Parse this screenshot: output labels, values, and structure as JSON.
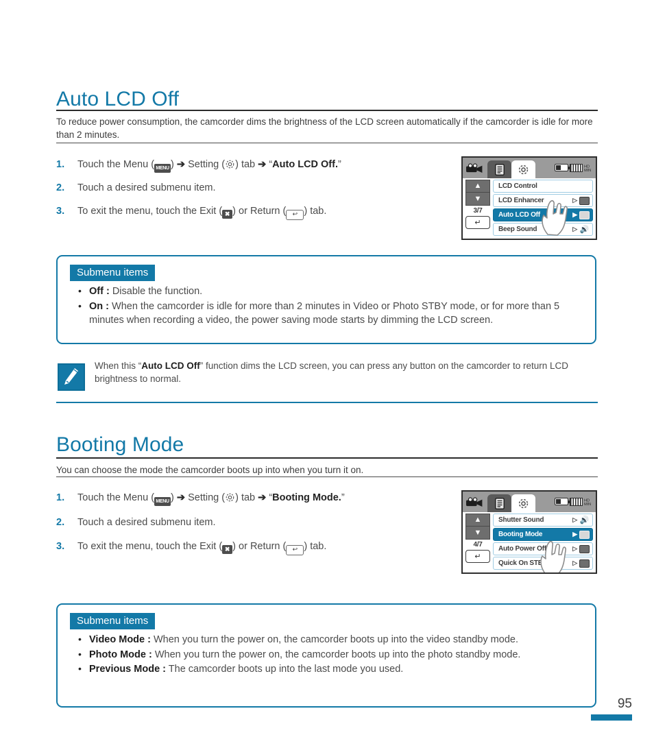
{
  "colors": {
    "accent": "#1379a7",
    "text": "#4b4b4b",
    "heading": "#1379a7",
    "rule": "#2b2b2b"
  },
  "sections": [
    {
      "id": "auto-lcd-off",
      "title": "Auto LCD Off",
      "lede": "To reduce power consumption, the camcorder dims the brightness of the LCD screen automatically if the camcorder is idle for more than 2 minutes.",
      "steps": [
        {
          "num": "1.",
          "pre": "Touch the Menu (",
          "icon1": "MENU",
          "mid1": ") ",
          "arrow1": "➔",
          "mid2": " Setting (",
          "icon2": "gear-icon",
          "mid3": ") tab ",
          "arrow2": "➔",
          "mid4": " “",
          "bold": "Auto LCD Off.",
          "post": "”"
        },
        {
          "num": "2.",
          "text": "Touch a desired submenu item."
        },
        {
          "num": "3.",
          "pre": "To exit the menu, touch the Exit (",
          "icon1": "✖",
          "mid1": ") or Return (",
          "icon2": "↩",
          "post": ") tab."
        }
      ],
      "lcd": {
        "page_indicator": "3/7",
        "tabs": [
          "camcorder-icon",
          "list-icon",
          "gear-icon"
        ],
        "rows": [
          {
            "label": "LCD Control",
            "play": "",
            "icon": ""
          },
          {
            "label": "LCD Enhancer",
            "play": "▷",
            "icon": "lcd-enhancer-icon",
            "selected": false
          },
          {
            "label": "Auto LCD Off",
            "play": "▶",
            "icon": "auto-lcd-off-icon",
            "selected": true
          },
          {
            "label": "Beep Sound",
            "play": "▷",
            "icon": "beep-sound-icon",
            "selected": false
          }
        ]
      },
      "submenu": {
        "badge": "Submenu items",
        "items": [
          {
            "term": "Off :",
            "desc": " Disable the function."
          },
          {
            "term": "On :",
            "desc": " When the camcorder is idle for more than 2 minutes in Video or Photo STBY mode, or for more than 5 minutes when recording a video, the power saving mode starts by dimming the LCD screen."
          }
        ]
      },
      "note": {
        "icon": "note-pencil-icon",
        "pre": "When this “",
        "bold": "Auto LCD Off",
        "post": "” function dims the LCD screen, you can press any button on the camcorder to return LCD brightness to normal."
      }
    },
    {
      "id": "booting-mode",
      "title": "Booting Mode",
      "lede": "You can choose the mode the camcorder boots up into when you turn it on.",
      "steps": [
        {
          "num": "1.",
          "pre": "Touch the Menu (",
          "icon1": "MENU",
          "mid1": ") ",
          "arrow1": "➔",
          "mid2": " Setting (",
          "icon2": "gear-icon",
          "mid3": ") tab ",
          "arrow2": "➔",
          "mid4": " “",
          "bold": "Booting Mode.",
          "post": "”"
        },
        {
          "num": "2.",
          "text": "Touch a desired submenu item."
        },
        {
          "num": "3.",
          "pre": "To exit the menu, touch the Exit (",
          "icon1": "✖",
          "mid1": ") or Return (",
          "icon2": "↩",
          "post": ") tab."
        }
      ],
      "lcd": {
        "page_indicator": "4/7",
        "tabs": [
          "camcorder-icon",
          "list-icon",
          "gear-icon"
        ],
        "rows": [
          {
            "label": "Shutter Sound",
            "play": "▷",
            "icon": "shutter-sound-icon",
            "selected": false
          },
          {
            "label": "Booting Mode",
            "play": "▶",
            "icon": "booting-mode-icon",
            "selected": true
          },
          {
            "label": "Auto Power Off",
            "play": "▷",
            "icon": "auto-power-off-icon",
            "selected": false
          },
          {
            "label": "Quick On STBY",
            "play": "▷",
            "icon": "quick-on-stby-icon",
            "selected": false
          }
        ]
      },
      "submenu": {
        "badge": "Submenu items",
        "items": [
          {
            "term": "Video Mode :",
            "desc": " When you turn the power on, the camcorder boots up into the video standby mode."
          },
          {
            "term": "Photo Mode :",
            "desc": " When you turn the power on, the camcorder boots up into the photo standby mode."
          },
          {
            "term": "Previous Mode :",
            "desc": " The camcorder boots up into the last mode you used."
          }
        ]
      }
    }
  ],
  "footer": {
    "page_number": "95"
  }
}
